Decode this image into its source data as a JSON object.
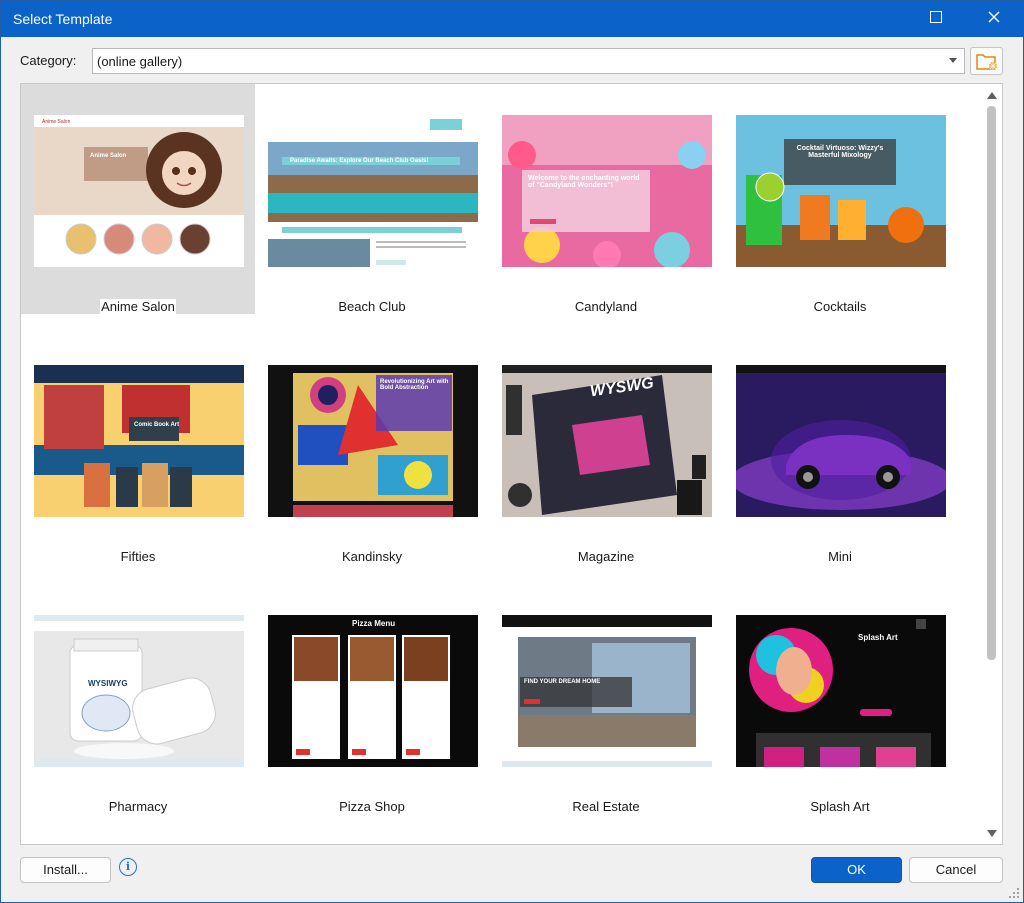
{
  "window": {
    "title": "Select Template",
    "maximize_icon": "maximize-icon",
    "close_icon": "close-icon"
  },
  "category": {
    "label": "Category:",
    "value": "(online gallery)",
    "folder_icon": "folder-icon"
  },
  "templates": [
    {
      "name": "Anime Salon",
      "caption": "Anime Salon",
      "selected": true
    },
    {
      "name": "Beach Club",
      "caption": "Paradise Awaits: Explore Our Beach Club Oasis!"
    },
    {
      "name": "Candyland",
      "caption": "Welcome to the enchanting world of \"Candyland Wonders\"!"
    },
    {
      "name": "Cocktails",
      "caption": "Cocktail Virtuoso: Wizzy's Masterful Mixology"
    },
    {
      "name": "Fifties",
      "caption": "Comic Book Art"
    },
    {
      "name": "Kandinsky",
      "caption": "Revolutionizing Art with Bold Abstraction"
    },
    {
      "name": "Magazine",
      "caption": "WYSWG"
    },
    {
      "name": "Mini",
      "caption": ""
    },
    {
      "name": "Pharmacy",
      "caption": "WYSIWYG"
    },
    {
      "name": "Pizza Shop",
      "caption": "Pizza Menu"
    },
    {
      "name": "Real Estate",
      "caption": "FIND YOUR DREAM HOME"
    },
    {
      "name": "Splash Art",
      "caption": "Splash Art"
    }
  ],
  "buttons": {
    "install": "Install...",
    "ok": "OK",
    "cancel": "Cancel",
    "info_icon": "info-icon"
  },
  "colors": {
    "accent": "#0b63c9",
    "selected_tile": "#dcdcdc",
    "folder": "#f0a020"
  }
}
